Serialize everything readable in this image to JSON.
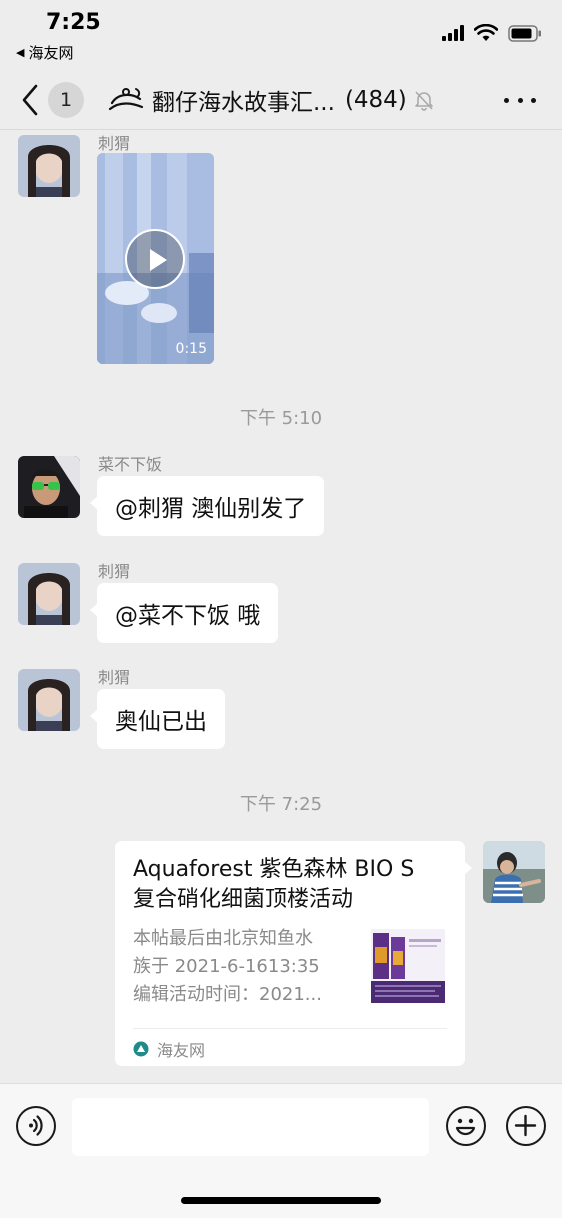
{
  "status_bar": {
    "time": "7:25",
    "back_app": "海友网"
  },
  "nav": {
    "unread_count": "1",
    "title": "翻仔海水故事汇...",
    "member_count": "(484)",
    "icons": [
      "back-chevron-icon",
      "group-logo-icon",
      "mute-bell-icon",
      "more-icon"
    ]
  },
  "messages": [
    {
      "sender": "刺猬",
      "type": "video",
      "duration": "0:15"
    },
    {
      "type": "timestamp",
      "text": "下午 5:10"
    },
    {
      "sender": "菜不下饭",
      "type": "text",
      "text": "@刺猬 澳仙别发了"
    },
    {
      "sender": "刺猬",
      "type": "text",
      "text": "@菜不下饭 哦"
    },
    {
      "sender": "刺猬",
      "type": "text",
      "text": "奥仙已出"
    },
    {
      "type": "timestamp",
      "text": "下午 7:25"
    },
    {
      "sender": "self",
      "type": "link",
      "title_line1": "Aquaforest 紫色森林 BIO S",
      "title_line2": "复合硝化细菌顶楼活动",
      "desc_line1": "本帖最后由北京知鱼水",
      "desc_line2": "族于 2021-6-1613:35",
      "desc_line3": "编辑活动时间：2021...",
      "source": "海友网"
    }
  ],
  "input_bar": {
    "placeholder": "",
    "icons": [
      "voice-icon",
      "emoji-icon",
      "add-icon"
    ]
  }
}
